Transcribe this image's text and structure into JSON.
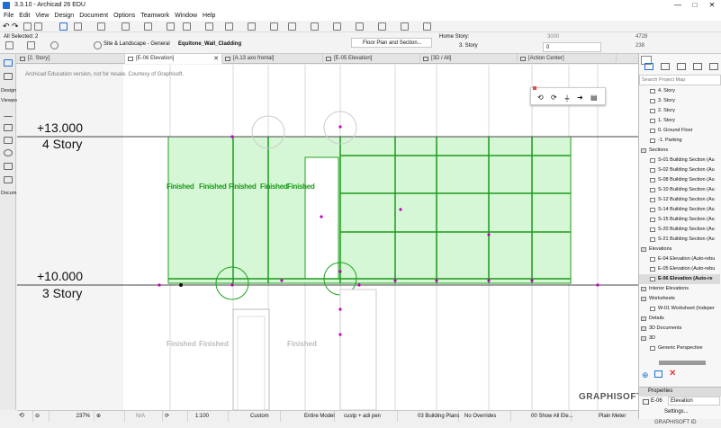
{
  "window": {
    "title": "3.3.10 - Archicad 26 EDU",
    "controls": [
      "—",
      "□",
      "✕"
    ]
  },
  "menu": [
    "File",
    "Edit",
    "View",
    "Design",
    "Document",
    "Options",
    "Teamwork",
    "Window",
    "Help"
  ],
  "infobox": {
    "selected": "All Selected: 2",
    "layer_combo": "Site & Landscape - General",
    "element": "Equitone_Wall_Cladding",
    "view_combo": "Floor Plan and Section...",
    "home_story_label": "Home Story:",
    "home_story_value": "3. Story",
    "offset_top": "3000",
    "offset_bottom": "0",
    "dim_top": "4728",
    "dim_bottom": "238"
  },
  "tabs": [
    {
      "label": "[2. Story]",
      "active": false
    },
    {
      "label": "[E-06 Elevation]",
      "active": true
    },
    {
      "label": "[A.13 axo frontal]",
      "active": false
    },
    {
      "label": "[E-05 Elevation]",
      "active": false
    },
    {
      "label": "[3D / All]",
      "active": false
    },
    {
      "label": "[Action Center]",
      "active": false
    }
  ],
  "toolbox": [
    "Design",
    "Viewpo",
    "Docum"
  ],
  "canvas": {
    "watermark": "Archicad Education version, not for resale. Courtesy of Graphisoft.",
    "level_upper_value": "+13.000",
    "level_upper_name": "4 Story",
    "level_lower_value": "+10.000",
    "level_lower_name": "3 Story",
    "finished_label": "Finished",
    "brand": "GRAPHISOFT."
  },
  "navigator": {
    "search_placeholder": "Search Project Map",
    "items": [
      {
        "label": "4. Story",
        "indent": 10,
        "icon": "story"
      },
      {
        "label": "3. Story",
        "indent": 10,
        "icon": "story"
      },
      {
        "label": "2. Story",
        "indent": 10,
        "icon": "story"
      },
      {
        "label": "1. Story",
        "indent": 10,
        "icon": "story"
      },
      {
        "label": "0. Ground Floor",
        "indent": 10,
        "icon": "story"
      },
      {
        "label": "-1. Parking",
        "indent": 10,
        "icon": "story"
      },
      {
        "label": "Sections",
        "indent": 0,
        "icon": "folder"
      },
      {
        "label": "S-01 Building Section (Au",
        "indent": 10,
        "icon": "section"
      },
      {
        "label": "S-02 Building Section (Au",
        "indent": 10,
        "icon": "section"
      },
      {
        "label": "S-08 Building Section (Au",
        "indent": 10,
        "icon": "section"
      },
      {
        "label": "S-10 Building Section (Au",
        "indent": 10,
        "icon": "section"
      },
      {
        "label": "S-12 Building Section (Au",
        "indent": 10,
        "icon": "section"
      },
      {
        "label": "S-14 Building Section (Au",
        "indent": 10,
        "icon": "section"
      },
      {
        "label": "S-15 Building Section (Au",
        "indent": 10,
        "icon": "section"
      },
      {
        "label": "S-20 Building Section (Au",
        "indent": 10,
        "icon": "section"
      },
      {
        "label": "S-21 Building Section (Au",
        "indent": 10,
        "icon": "section"
      },
      {
        "label": "Elevations",
        "indent": 0,
        "icon": "folder"
      },
      {
        "label": "E-04 Elevation (Auto-rebu",
        "indent": 10,
        "icon": "section"
      },
      {
        "label": "E-05 Elevation (Auto-rebu",
        "indent": 10,
        "icon": "section"
      },
      {
        "label": "E-06 Elevation (Auto-re",
        "indent": 10,
        "icon": "section",
        "selected": true
      },
      {
        "label": "Interior Elevations",
        "indent": 0,
        "icon": "folder"
      },
      {
        "label": "Worksheets",
        "indent": 0,
        "icon": "folder"
      },
      {
        "label": "W-01 Worksheet (Indeper",
        "indent": 10,
        "icon": "section"
      },
      {
        "label": "Details",
        "indent": 0,
        "icon": "folder"
      },
      {
        "label": "3D Documents",
        "indent": 0,
        "icon": "folder"
      },
      {
        "label": "3D",
        "indent": 0,
        "icon": "folder"
      },
      {
        "label": "Generic Perspective",
        "indent": 10,
        "icon": "section"
      }
    ],
    "properties_title": "Properties",
    "prop_id": "E-06",
    "prop_name": "Elevation",
    "settings_button": "Settings...",
    "graphisoft_id": "GRAPHISOFT ID"
  },
  "status": {
    "zoom": "237%",
    "angle": "N/A",
    "scale": "1:100",
    "custom": "Custom",
    "model": "Entire Model",
    "pen": "custp + adi pen",
    "layers": "03 Building Plans",
    "overrides": "No Overrides",
    "renovation": "00 Show All Ele...",
    "dimension": "Plain Meter"
  },
  "colors": {
    "green_fill": "#d5f8d5",
    "green_line": "#1fa11f",
    "magenta": "#c000c0"
  }
}
